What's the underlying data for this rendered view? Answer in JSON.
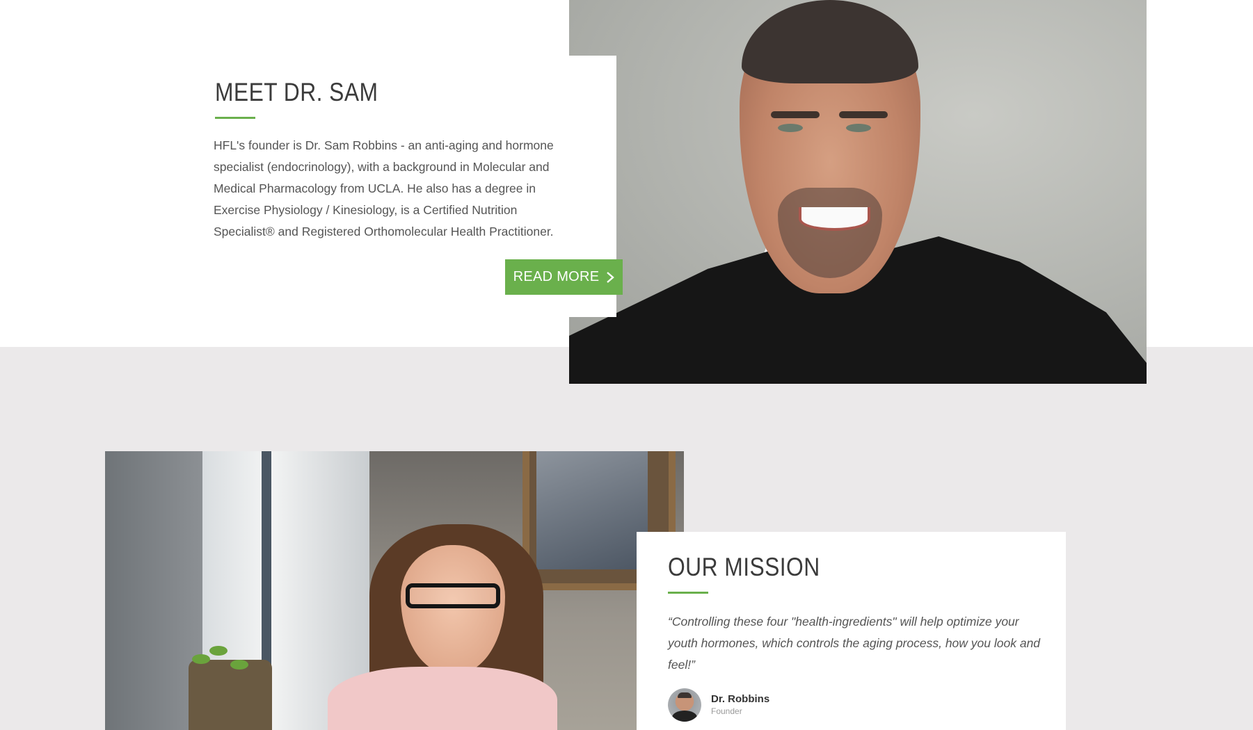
{
  "meet_section": {
    "title": "MEET DR. SAM",
    "body": "HFL's founder is Dr. Sam Robbins - an anti-aging and hormone specialist (endocrinology), with a background in Molecular and Medical Pharmacology from UCLA. He also has a degree in Exercise Physiology / Kinesiology, is a Certified Nutrition Specialist® and Registered Orthomolecular Health Practitioner.",
    "button_label": "READ MORE",
    "button_icon": "chevron-right-icon",
    "photo_icon": "dr-sam-portrait-photo"
  },
  "mission_section": {
    "title": "OUR MISSION",
    "quote": "“Controlling these four \"health-ingredients\" will help optimize your youth hormones, which controls the aging process, how you look and feel!”",
    "author_name": "Dr. Robbins",
    "author_role": "Founder",
    "photo_icon": "woman-with-phone-photo"
  },
  "colors": {
    "accent": "#6ab04c",
    "band_background": "#ebe9ea",
    "heading": "#3b3b3b",
    "body_text": "#555555"
  }
}
